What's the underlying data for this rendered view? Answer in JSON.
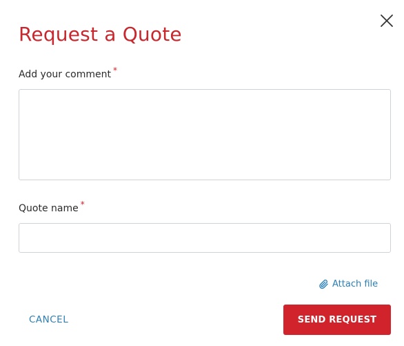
{
  "dialog": {
    "title": "Request a Quote",
    "close_icon": "close-icon"
  },
  "form": {
    "comment": {
      "label": "Add your comment",
      "required_marker": "*",
      "value": "",
      "placeholder": ""
    },
    "quote_name": {
      "label": "Quote name",
      "required_marker": "*",
      "value": "",
      "placeholder": ""
    },
    "attach": {
      "label": "Attach file",
      "icon": "paperclip-icon"
    }
  },
  "actions": {
    "cancel_label": "CANCEL",
    "send_label": "SEND REQUEST"
  },
  "colors": {
    "title": "#c6282e",
    "required": "#d0202a",
    "link": "#2a7fb8",
    "primary_button": "#d0232b",
    "input_border": "#cfd3d7"
  }
}
